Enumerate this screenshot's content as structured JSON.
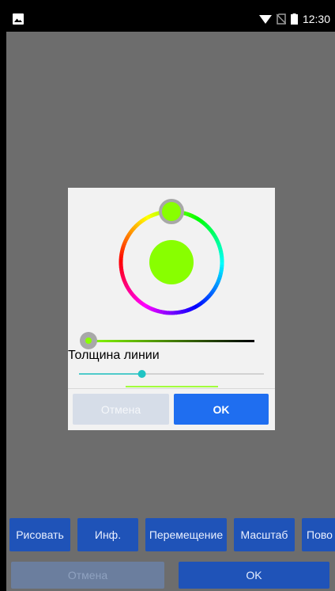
{
  "status_bar": {
    "time": "12:30",
    "icons": [
      "image-icon",
      "wifi-icon",
      "no-sim-icon",
      "battery-icon"
    ]
  },
  "dialog": {
    "selected_color": "#88ff00",
    "opacity_color": "#88ff00",
    "line_width_label": "Толщина линии",
    "line_width_level": 0.34,
    "line_preview_color": "#88ff00",
    "cancel_label": "Отмена",
    "ok_label": "OK"
  },
  "toolbar": {
    "buttons": [
      "Рисовать",
      "Инф.",
      "Перемещение",
      "Масштаб",
      "Пово"
    ]
  },
  "bottom": {
    "cancel_label": "Отмена",
    "ok_label": "OK"
  },
  "colors": {
    "accent_blue": "#1f53b8",
    "dialog_ok": "#1f6ef0",
    "slider_teal": "#20c4c4",
    "overlay_gray": "#6d6d6d"
  }
}
